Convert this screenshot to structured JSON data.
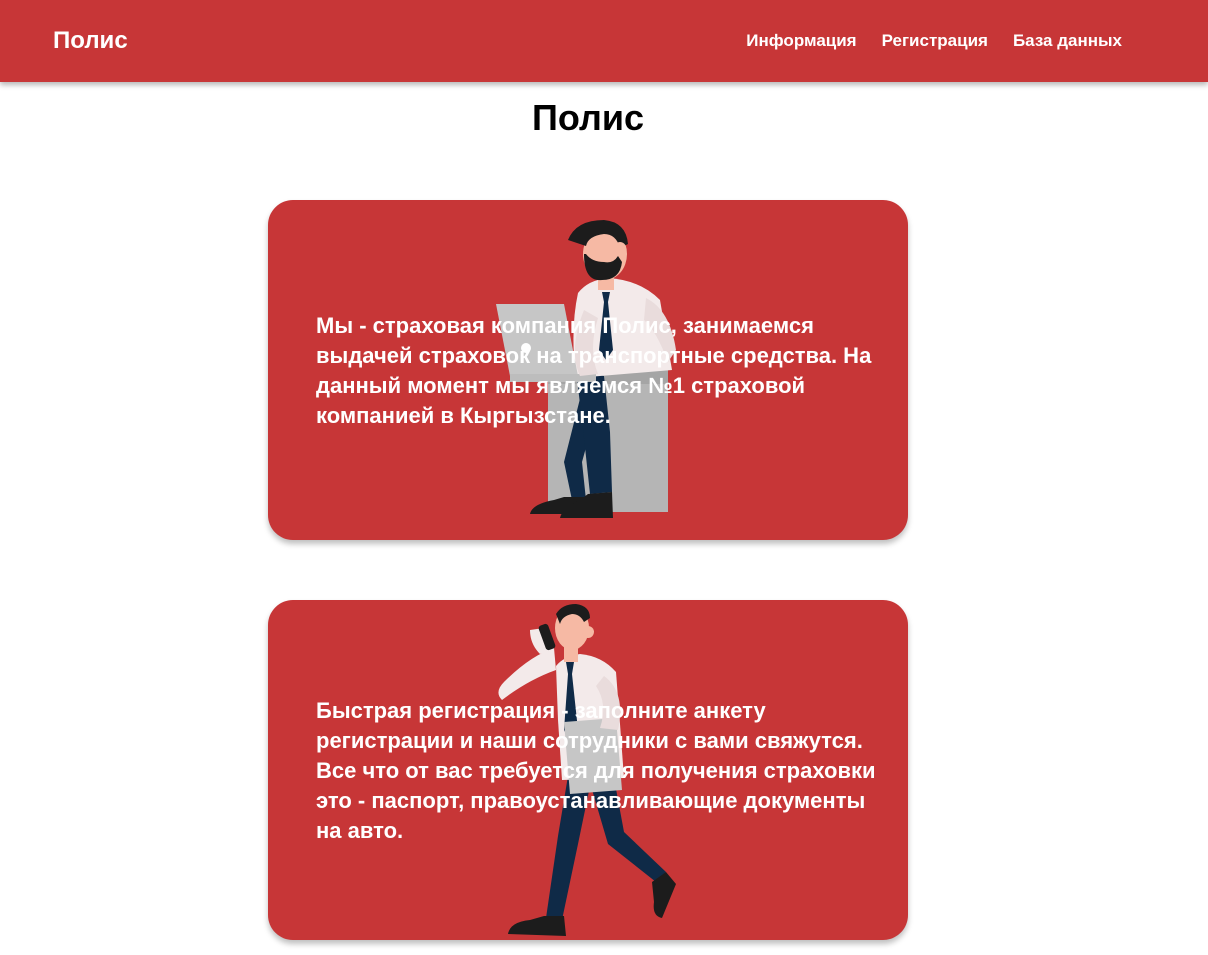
{
  "navbar": {
    "brand": "Полис",
    "links": [
      {
        "label": "Информация"
      },
      {
        "label": "Регистрация"
      },
      {
        "label": "База данных"
      }
    ]
  },
  "page": {
    "title": "Полис"
  },
  "cards": [
    {
      "text": "Мы - страховая компания Полис, занимаемся выдачей страховок на транспортные средства. На данный момент мы являемся №1 страховой компанией в Кыргызстане.",
      "illustration": "man-sitting-with-laptop"
    },
    {
      "text": "Быстрая регистрация - заполните анкету регистрации и наши сотрудники с вами свяжутся. Все что от вас требуется для получения страховки это - паспорт, правоустанавливающие документы на авто.",
      "illustration": "man-walking-with-phone"
    }
  ],
  "colors": {
    "brand_red": "#c73637",
    "shirt": "#f3eaea",
    "trousers": "#0f2a47",
    "skin": "#f6b9a4",
    "hair": "#1c1c1c",
    "stand": "#b5b5b5"
  }
}
